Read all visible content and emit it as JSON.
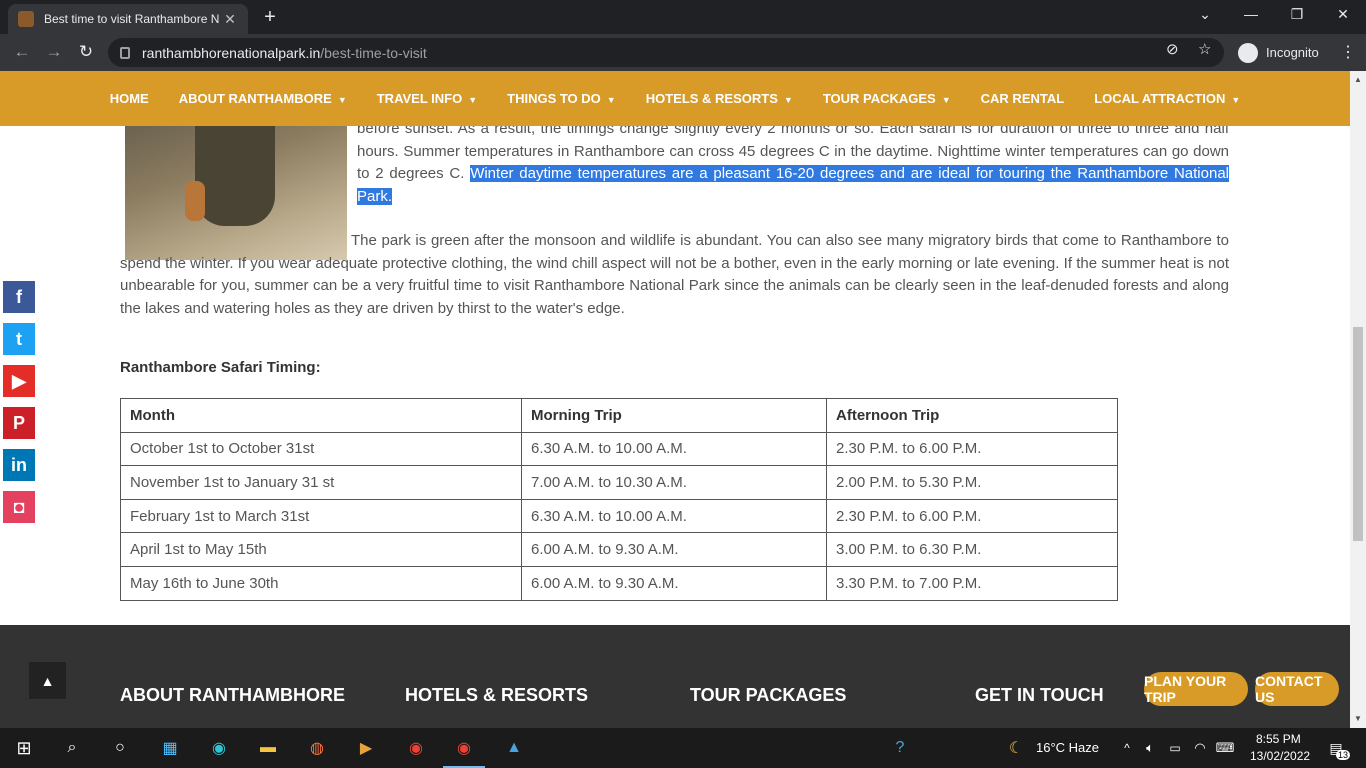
{
  "browser": {
    "tab_title": "Best time to visit Ranthambore N",
    "tab_close": "✕",
    "new_tab": "+",
    "url_host": "ranthambhorenationalpark.in",
    "url_path": "/best-time-to-visit",
    "incognito_label": "Incognito"
  },
  "nav": {
    "items": [
      {
        "label": "HOME",
        "dropdown": false
      },
      {
        "label": "ABOUT RANTHAMBORE",
        "dropdown": true
      },
      {
        "label": "TRAVEL INFO",
        "dropdown": true
      },
      {
        "label": "THINGS TO DO",
        "dropdown": true
      },
      {
        "label": "HOTELS & RESORTS",
        "dropdown": true
      },
      {
        "label": "TOUR PACKAGES",
        "dropdown": true
      },
      {
        "label": "CAR RENTAL",
        "dropdown": false
      },
      {
        "label": "LOCAL ATTRACTION",
        "dropdown": true
      }
    ],
    "caret": "▼"
  },
  "content": {
    "para1_plain": "before sunset. As a result, the timings change slightly every 2 months or so. Each safari is for duration of three to three and half hours.  Summer temperatures in Ranthambore can cross 45 degrees C in the daytime. Nighttime winter temperatures can go down to 2 degrees C. ",
    "para1_highlight": "Winter daytime temperatures are a pleasant 16-20 degrees and are  ideal for touring the Ranthambore National Park.",
    "para2": "The park is green after the monsoon and wildlife is abundant. You can also see many migratory birds that come to Ranthambore to spend the winter. If you wear adequate protective clothing, the wind chill aspect will not be a bother, even in the early morning or late evening. If the summer heat is not unbearable for you, summer can be a very fruitful time to visit Ranthambore National Park since the animals can be clearly seen in the leaf-denuded forests and along the lakes and watering holes as they are driven by thirst to the water's edge.",
    "subhead": "Ranthambore Safari Timing:",
    "table": {
      "headers": [
        "Month",
        "Morning Trip",
        "Afternoon Trip"
      ],
      "rows": [
        [
          "October 1st to October 31st",
          "6.30 A.M. to 10.00 A.M.",
          "2.30 P.M. to 6.00 P.M."
        ],
        [
          "November 1st to January 31 st",
          "7.00 A.M. to 10.30 A.M.",
          "2.00 P.M. to 5.30 P.M."
        ],
        [
          "February 1st to March 31st",
          "6.30 A.M. to 10.00 A.M.",
          "2.30 P.M. to 6.00 P.M."
        ],
        [
          "April 1st to May 15th",
          "6.00 A.M. to 9.30 A.M.",
          "3.00 P.M. to 6.30 P.M."
        ],
        [
          "May 16th to June 30th",
          "6.00 A.M. to 9.30 A.M.",
          "3.30 P.M. to 7.00 P.M."
        ]
      ]
    }
  },
  "social": [
    {
      "name": "facebook-icon",
      "glyph": "f",
      "color": "#3b5998"
    },
    {
      "name": "twitter-icon",
      "glyph": "t",
      "color": "#1da1f2"
    },
    {
      "name": "youtube-icon",
      "glyph": "▶",
      "color": "#e52d27"
    },
    {
      "name": "pinterest-icon",
      "glyph": "P",
      "color": "#cb2027"
    },
    {
      "name": "linkedin-icon",
      "glyph": "in",
      "color": "#0077b5"
    },
    {
      "name": "instagram-icon",
      "glyph": "◘",
      "color": "#e4405f"
    }
  ],
  "footer": {
    "headings": [
      "ABOUT RANTHAMBHORE",
      "HOTELS & RESORTS",
      "TOUR PACKAGES",
      "GET IN TOUCH"
    ],
    "plan_button": "PLAN YOUR TRIP",
    "contact_button": "CONTACT US",
    "to_top": "▲"
  },
  "taskbar": {
    "weather": "16°C  Haze",
    "time": "8:55 PM",
    "date": "13/02/2022",
    "notifications": "13"
  },
  "colors": {
    "accent": "#d89b27",
    "footer_bg": "#333333",
    "highlight": "#2f79e0"
  }
}
